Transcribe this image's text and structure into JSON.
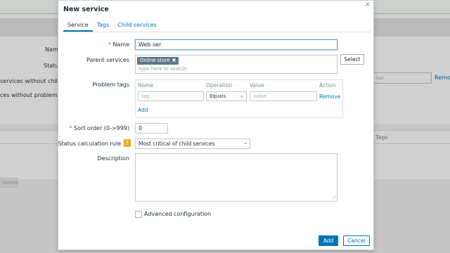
{
  "background": {
    "labels": [
      "Name",
      "Status",
      "services without children",
      "ces without problem tags"
    ],
    "remove_link": "Remo",
    "input_placeholder": "lue",
    "table_col_tags": "Tags",
    "delete_button": "Delete"
  },
  "modal": {
    "title": "New service",
    "close_icon": "×",
    "tabs": [
      {
        "label": "Service",
        "active": true
      },
      {
        "label": "Tags"
      },
      {
        "label": "Child services"
      }
    ],
    "name": {
      "label": "Name",
      "value": "Web ser"
    },
    "parent_services": {
      "label": "Parent services",
      "selected": [
        "Online store"
      ],
      "remove_glyph": "✖",
      "placeholder": "type here to search",
      "select_button": "Select"
    },
    "problem_tags": {
      "label": "Problem tags",
      "headers": [
        "Name",
        "Operation",
        "Value",
        "Action"
      ],
      "row": {
        "tag_placeholder": "tag",
        "operation": "Equals",
        "value_placeholder": "value",
        "remove": "Remove"
      },
      "add": "Add"
    },
    "sort_order": {
      "label": "Sort order (0->999)",
      "value": "0"
    },
    "status_calc": {
      "label": "Status calculation rule",
      "warn": "!",
      "value": "Most critical of child services"
    },
    "description": {
      "label": "Description",
      "value": ""
    },
    "advanced": {
      "label": "Advanced configuration",
      "checked": false
    },
    "buttons": {
      "add": "Add",
      "cancel": "Cancel"
    },
    "required_mark": "*",
    "chevron": "⌄",
    "resize_glyph": "⟋"
  }
}
